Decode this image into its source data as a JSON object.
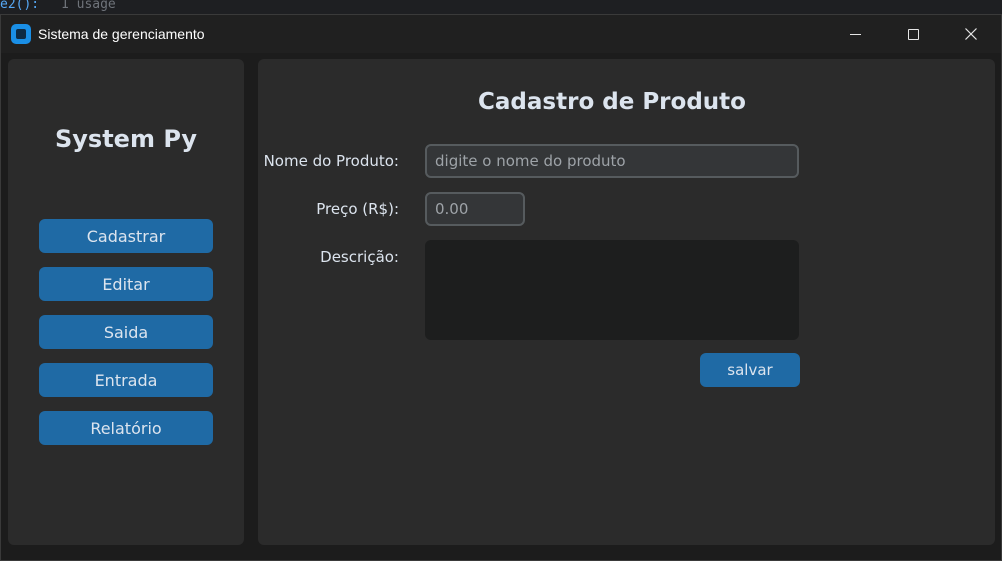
{
  "background_editor": {
    "code": "e2():",
    "hint": "1 usage"
  },
  "window": {
    "title": "Sistema de gerenciamento",
    "controls": {
      "minimize": "—",
      "maximize": "☐",
      "close": "✕"
    }
  },
  "sidebar": {
    "brand": "System Py",
    "items": [
      {
        "label": "Cadastrar"
      },
      {
        "label": "Editar"
      },
      {
        "label": "Saida"
      },
      {
        "label": "Entrada"
      },
      {
        "label": "Relatório"
      }
    ]
  },
  "form": {
    "title": "Cadastro de Produto",
    "name": {
      "label": "Nome do Produto:",
      "value": "",
      "placeholder": "digite o nome do produto"
    },
    "price": {
      "label": "Preço (R$):",
      "value": "",
      "placeholder": "0.00"
    },
    "description": {
      "label": "Descrição:",
      "value": ""
    },
    "save_label": "salvar"
  },
  "colors": {
    "accent": "#1f6aa5",
    "panel": "#2b2b2b",
    "window_bg": "#1c1c1c",
    "entry_bg": "#343638",
    "entry_border": "#565b5e",
    "textbox_bg": "#1d1e1e",
    "text": "#dce4ee",
    "app_icon": "#1a8fe6"
  },
  "icons": {
    "app": "app-icon",
    "minimize": "minimize-icon",
    "maximize": "maximize-icon",
    "close": "close-icon"
  }
}
